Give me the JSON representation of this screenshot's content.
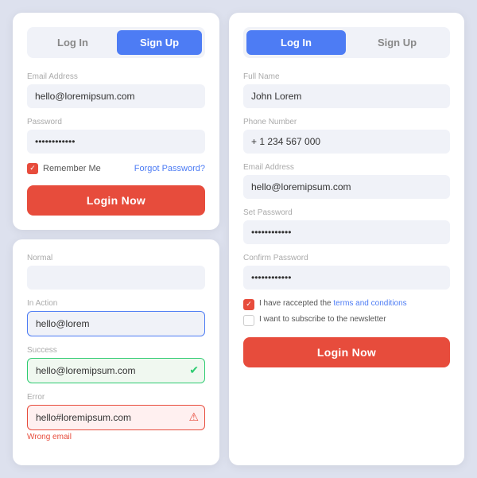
{
  "left_top_card": {
    "tab_login": "Log In",
    "tab_signup": "Sign Up",
    "email_label": "Email Address",
    "email_value": "hello@loremipsum.com",
    "password_label": "Password",
    "password_dots": "••••••••••••",
    "remember_label": "Remember Me",
    "forgot_label": "Forgot Password?",
    "login_btn": "Login Now"
  },
  "left_bottom_card": {
    "normal_label": "Normal",
    "normal_value": "",
    "in_action_label": "In Action",
    "in_action_value": "hello@lorem",
    "success_label": "Success",
    "success_value": "hello@loremipsum.com",
    "error_label": "Error",
    "error_value": "hello#loremipsum.com",
    "error_msg": "Wrong email"
  },
  "right_card": {
    "tab_login": "Log In",
    "tab_signup": "Sign Up",
    "fullname_label": "Full Name",
    "fullname_value": "John Lorem",
    "phone_label": "Phone Number",
    "phone_value": "+ 1 234 567 000",
    "email_label": "Email Address",
    "email_value": "hello@loremipsum.com",
    "set_password_label": "Set Password",
    "set_password_dots": "••••••••••••",
    "confirm_password_label": "Confirm Password",
    "confirm_password_dots": "••••••••••••",
    "terms_text1": "I have raccepted the ",
    "terms_link": "terms and conditions",
    "newsletter_text": "I want to subscribe to the newsletter",
    "login_btn": "Login Now"
  }
}
